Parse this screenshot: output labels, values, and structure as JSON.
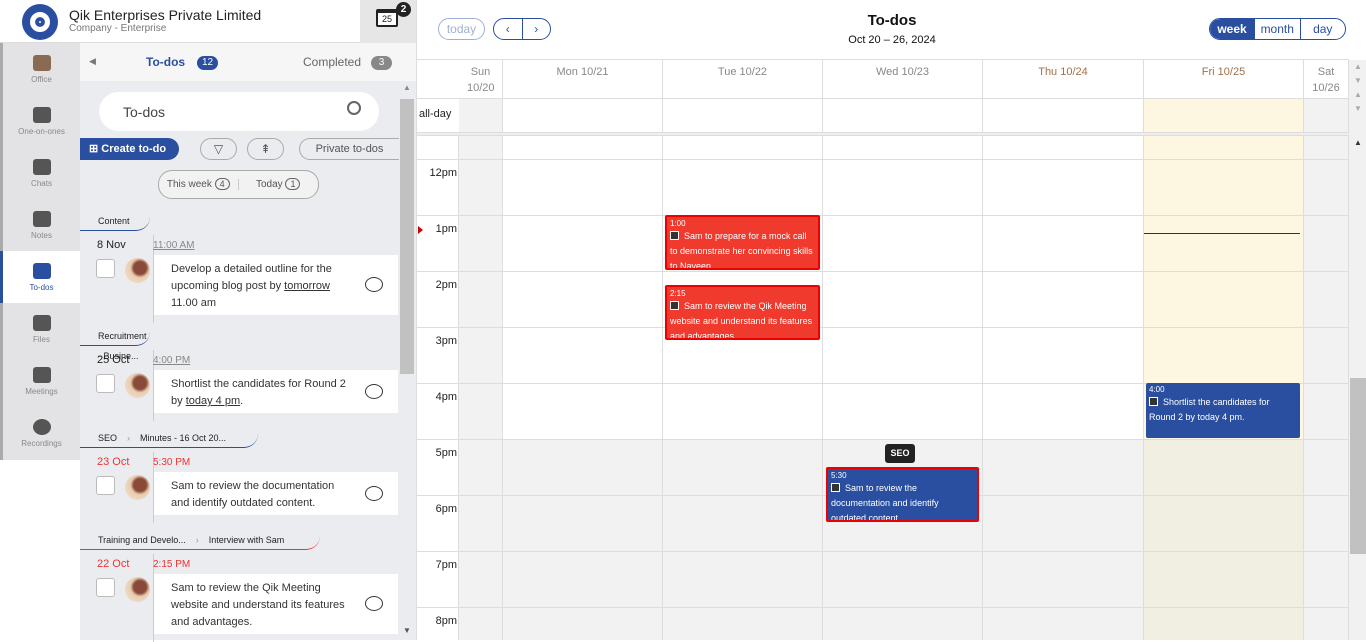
{
  "app": {
    "company": "Qik Enterprises Private Limited",
    "subtitle": "Company - Enterprise",
    "calendar_day": "25",
    "notification_count": "2"
  },
  "nav": [
    {
      "label": "Office",
      "icon": "briefcase-icon"
    },
    {
      "label": "One-on-ones",
      "icon": "people-icon"
    },
    {
      "label": "Chats",
      "icon": "chat-icon"
    },
    {
      "label": "Notes",
      "icon": "notes-icon"
    },
    {
      "label": "To-dos",
      "icon": "checkbox-icon",
      "active": true
    },
    {
      "label": "Files",
      "icon": "files-icon"
    },
    {
      "label": "Meetings",
      "icon": "meetings-icon"
    },
    {
      "label": "Recordings",
      "icon": "recordings-icon"
    }
  ],
  "panel": {
    "tab_todos": "To-dos",
    "todos_count": "12",
    "tab_completed": "Completed",
    "completed_count": "3",
    "search_value": "To-dos",
    "create_label": "Create to-do",
    "private_label": "Private to-dos",
    "this_week": "This week",
    "this_week_count": "4",
    "today": "Today",
    "today_count": "1",
    "items": [
      {
        "group": "Content",
        "date": "8 Nov",
        "time": "11:00 AM",
        "overdue": false,
        "text_a": "Develop a detailed outline for the upcoming blog post by ",
        "text_link": "tomorrow",
        "text_b": " 11.00 am"
      },
      {
        "group": "Recruitment - Busine...",
        "date": "25 Oct",
        "time": "4:00 PM",
        "overdue": false,
        "text_a": "Shortlist the candidates for Round 2 by ",
        "text_link": "today 4 pm",
        "text_b": "."
      },
      {
        "group": "SEO",
        "subgroup": "Minutes - 16 Oct 20...",
        "date": "23 Oct",
        "time": "5:30 PM",
        "overdue": true,
        "text_a": "Sam to review the documentation and identify outdated content.",
        "text_link": "",
        "text_b": ""
      },
      {
        "group": "Training and Develo...",
        "subgroup": "Interview with Sam",
        "date": "22 Oct",
        "time": "2:15 PM",
        "overdue": true,
        "text_a": "Sam to review the Qik Meeting website and understand its features and advantages.",
        "text_link": "",
        "text_b": ""
      }
    ]
  },
  "calendar": {
    "title": "To-dos",
    "range": "Oct 20 – 26, 2024",
    "today_btn": "today",
    "views": [
      "week",
      "month",
      "day"
    ],
    "active_view": "week",
    "allday": "all-day",
    "days": [
      "Sun 10/20",
      "Mon 10/21",
      "Tue 10/22",
      "Wed 10/23",
      "Thu 10/24",
      "Fri 10/25",
      "Sat 10/26"
    ],
    "hours": [
      "12pm",
      "1pm",
      "2pm",
      "3pm",
      "4pm",
      "5pm",
      "6pm",
      "7pm",
      "8pm"
    ],
    "events": [
      {
        "day": "Tue 10/22",
        "time": "1:00",
        "title": "Sam to prepare for a mock call to demonstrate her convincing skills to Naveen",
        "color": "#f03a2e"
      },
      {
        "day": "Tue 10/22",
        "time": "2:15",
        "title": "Sam to review the Qik Meeting website and understand its features and advantages",
        "color": "#f03a2e"
      },
      {
        "day": "Fri 10/25",
        "time": "4:00",
        "title": "Shortlist the candidates for Round 2 by today 4 pm.",
        "color": "#2a4fa0"
      },
      {
        "day": "Wed 10/23",
        "time": "5:30",
        "title": "Sam to review the documentation and identify outdated content",
        "color": "#2a4fa0"
      }
    ],
    "tooltip": "SEO"
  },
  "colors": {
    "brand": "#2a4fa0",
    "overdue": "#e33333",
    "today_bg": "#fdf7e1"
  }
}
